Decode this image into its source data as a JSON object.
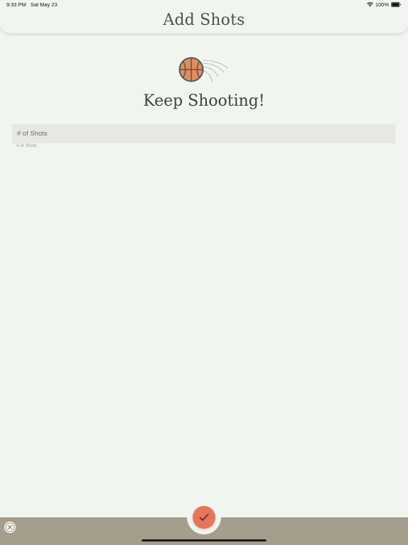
{
  "status_bar": {
    "time": "9:33 PM",
    "date": "Sat May 23",
    "battery": "100%",
    "icons": [
      "wifi-icon",
      "battery-icon"
    ]
  },
  "header": {
    "title": "Add Shots"
  },
  "hero": {
    "icon": "basketball-icon",
    "heading": "Keep Shooting!"
  },
  "form": {
    "shots_field": {
      "placeholder": "# of Shots",
      "value": "",
      "helper": "# of Shots"
    }
  },
  "bottom_bar": {
    "confirm_icon": "checkmark-icon",
    "close_icon": "close-icon"
  },
  "colors": {
    "background": "#f1f5ef",
    "accent": "#e8745a",
    "bottom_bar": "#a69e8c",
    "input_background": "#e6e8e1",
    "ball": "#e38b5f"
  }
}
